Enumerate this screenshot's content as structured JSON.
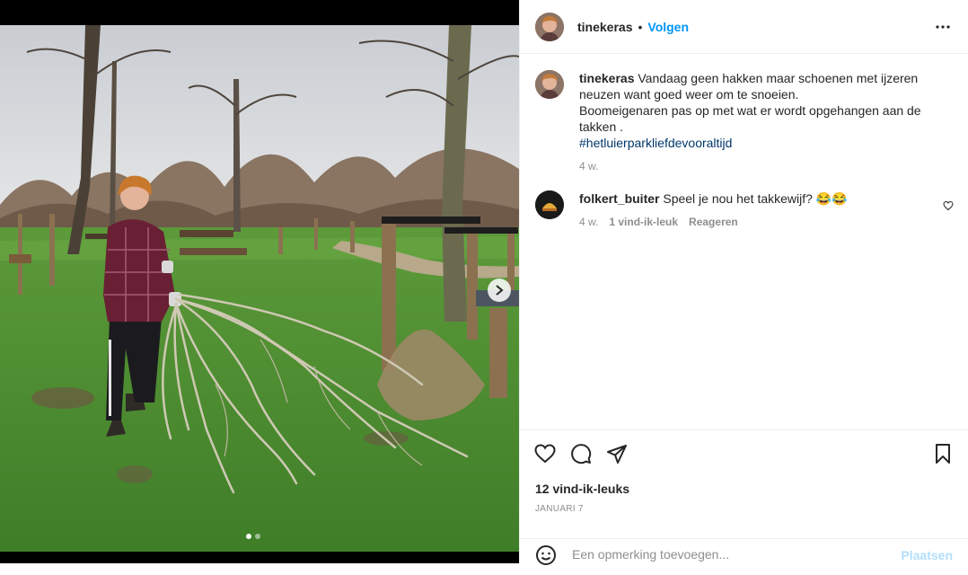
{
  "post": {
    "author": "tinekeras",
    "follow_label": "Volgen",
    "separator": "•"
  },
  "caption": {
    "username": "tinekeras",
    "text": "Vandaag geen hakken maar schoenen met ijzeren neuzen want goed weer om te snoeien.",
    "text2": "Boomeigenaren pas op met wat er wordt opgehangen aan de takken .",
    "hashtag": "#hetluierparkliefdevooraltijd",
    "time": "4 w."
  },
  "comments": [
    {
      "username": "folkert_buiter",
      "text": "Speel je nou het takkewijf? 😂😂",
      "time": "4 w.",
      "likes": "1 vind-ik-leuk",
      "reply_label": "Reageren"
    }
  ],
  "likes_count": "12 vind-ik-leuks",
  "date": "JANUARI 7",
  "comment_box": {
    "placeholder": "Een opmerking toevoegen...",
    "post_label": "Plaatsen"
  },
  "colors": {
    "accent": "#0095f6",
    "hashtag": "#00376b",
    "muted": "#8e8e8e",
    "post_disabled": "#b2dffc"
  },
  "icons": [
    "more-options-icon",
    "next-image-icon",
    "like-heart-icon",
    "comment-icon",
    "share-icon",
    "save-bookmark-icon",
    "emoji-icon",
    "comment-like-heart-icon"
  ],
  "carousel": {
    "slides": 2,
    "active": 1
  }
}
